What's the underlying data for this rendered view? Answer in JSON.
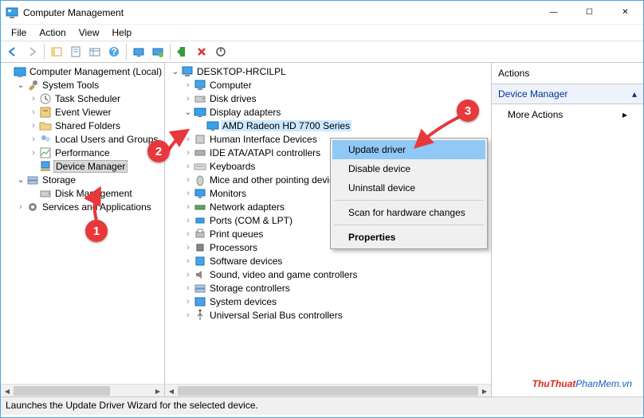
{
  "window": {
    "title": "Computer Management",
    "min": "—",
    "max": "☐",
    "close": "✕"
  },
  "menu": [
    "File",
    "Action",
    "View",
    "Help"
  ],
  "toolbar_icons": [
    "back",
    "forward",
    "up",
    "props",
    "table",
    "help",
    "monitor1",
    "monitor2",
    "play",
    "delete",
    "power"
  ],
  "left_tree": [
    {
      "d": 0,
      "tw": "",
      "icon": "mgmt",
      "label": "Computer Management (Local)"
    },
    {
      "d": 1,
      "tw": "v",
      "icon": "tools",
      "label": "System Tools"
    },
    {
      "d": 2,
      "tw": ">",
      "icon": "sched",
      "label": "Task Scheduler"
    },
    {
      "d": 2,
      "tw": ">",
      "icon": "event",
      "label": "Event Viewer"
    },
    {
      "d": 2,
      "tw": ">",
      "icon": "folder",
      "label": "Shared Folders"
    },
    {
      "d": 2,
      "tw": ">",
      "icon": "users",
      "label": "Local Users and Groups"
    },
    {
      "d": 2,
      "tw": ">",
      "icon": "perf",
      "label": "Performance"
    },
    {
      "d": 2,
      "tw": "",
      "icon": "devmgr",
      "label": "Device Manager",
      "selected": true
    },
    {
      "d": 1,
      "tw": "v",
      "icon": "storage",
      "label": "Storage"
    },
    {
      "d": 2,
      "tw": "",
      "icon": "disk",
      "label": "Disk Management"
    },
    {
      "d": 1,
      "tw": ">",
      "icon": "services",
      "label": "Services and Applications"
    }
  ],
  "mid_tree": [
    {
      "d": 0,
      "tw": "v",
      "icon": "pc",
      "label": "DESKTOP-HRCILPL"
    },
    {
      "d": 1,
      "tw": ">",
      "icon": "pc",
      "label": "Computer"
    },
    {
      "d": 1,
      "tw": ">",
      "icon": "disk",
      "label": "Disk drives"
    },
    {
      "d": 1,
      "tw": "v",
      "icon": "display",
      "label": "Display adapters"
    },
    {
      "d": 2,
      "tw": "",
      "icon": "display",
      "label": "AMD Radeon HD 7700 Series",
      "highlight": true
    },
    {
      "d": 1,
      "tw": ">",
      "icon": "hid",
      "label": "Human Interface Devices"
    },
    {
      "d": 1,
      "tw": ">",
      "icon": "ide",
      "label": "IDE ATA/ATAPI controllers"
    },
    {
      "d": 1,
      "tw": ">",
      "icon": "kb",
      "label": "Keyboards"
    },
    {
      "d": 1,
      "tw": ">",
      "icon": "mouse",
      "label": "Mice and other pointing devices"
    },
    {
      "d": 1,
      "tw": ">",
      "icon": "monitor",
      "label": "Monitors"
    },
    {
      "d": 1,
      "tw": ">",
      "icon": "net",
      "label": "Network adapters"
    },
    {
      "d": 1,
      "tw": ">",
      "icon": "port",
      "label": "Ports (COM & LPT)"
    },
    {
      "d": 1,
      "tw": ">",
      "icon": "print",
      "label": "Print queues"
    },
    {
      "d": 1,
      "tw": ">",
      "icon": "cpu",
      "label": "Processors"
    },
    {
      "d": 1,
      "tw": ">",
      "icon": "soft",
      "label": "Software devices"
    },
    {
      "d": 1,
      "tw": ">",
      "icon": "sound",
      "label": "Sound, video and game controllers"
    },
    {
      "d": 1,
      "tw": ">",
      "icon": "storage",
      "label": "Storage controllers"
    },
    {
      "d": 1,
      "tw": ">",
      "icon": "sys",
      "label": "System devices"
    },
    {
      "d": 1,
      "tw": ">",
      "icon": "usb",
      "label": "Universal Serial Bus controllers"
    }
  ],
  "context_menu": {
    "items": [
      {
        "label": "Update driver",
        "hover": true
      },
      {
        "label": "Disable device"
      },
      {
        "label": "Uninstall device"
      },
      {
        "sep": true
      },
      {
        "label": "Scan for hardware changes"
      },
      {
        "sep": true
      },
      {
        "label": "Properties",
        "bold": true
      }
    ]
  },
  "actions": {
    "header": "Actions",
    "section": "Device Manager",
    "more": "More Actions"
  },
  "status": "Launches the Update Driver Wizard for the selected device.",
  "callouts": {
    "1": "1",
    "2": "2",
    "3": "3"
  },
  "watermark": {
    "red": "ThuThuat",
    "blue": "PhanMem.vn"
  }
}
